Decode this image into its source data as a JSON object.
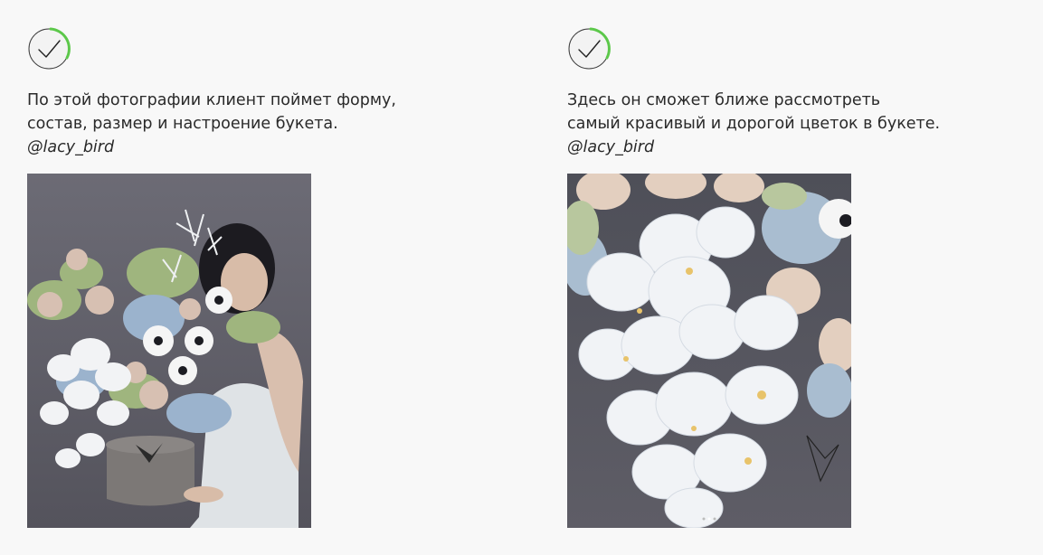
{
  "left": {
    "icon": "checkmark-circle-icon",
    "caption_line1": "По этой фотографии клиент поймет форму,",
    "caption_line2": "состав, размер и настроение букета.",
    "handle": "@lacy_bird",
    "photo": "bouquet-in-hatbox-photo"
  },
  "right": {
    "icon": "checkmark-circle-icon",
    "caption_line1": "Здесь он сможет ближе рассмотреть",
    "caption_line2": "самый красивый и дорогой цветок в букете.",
    "handle": "@lacy_bird",
    "photo": "orchid-closeup-photo"
  },
  "colors": {
    "background": "#f8f8f8",
    "check_accent": "#5cc84a",
    "text": "#2a2a2a"
  }
}
